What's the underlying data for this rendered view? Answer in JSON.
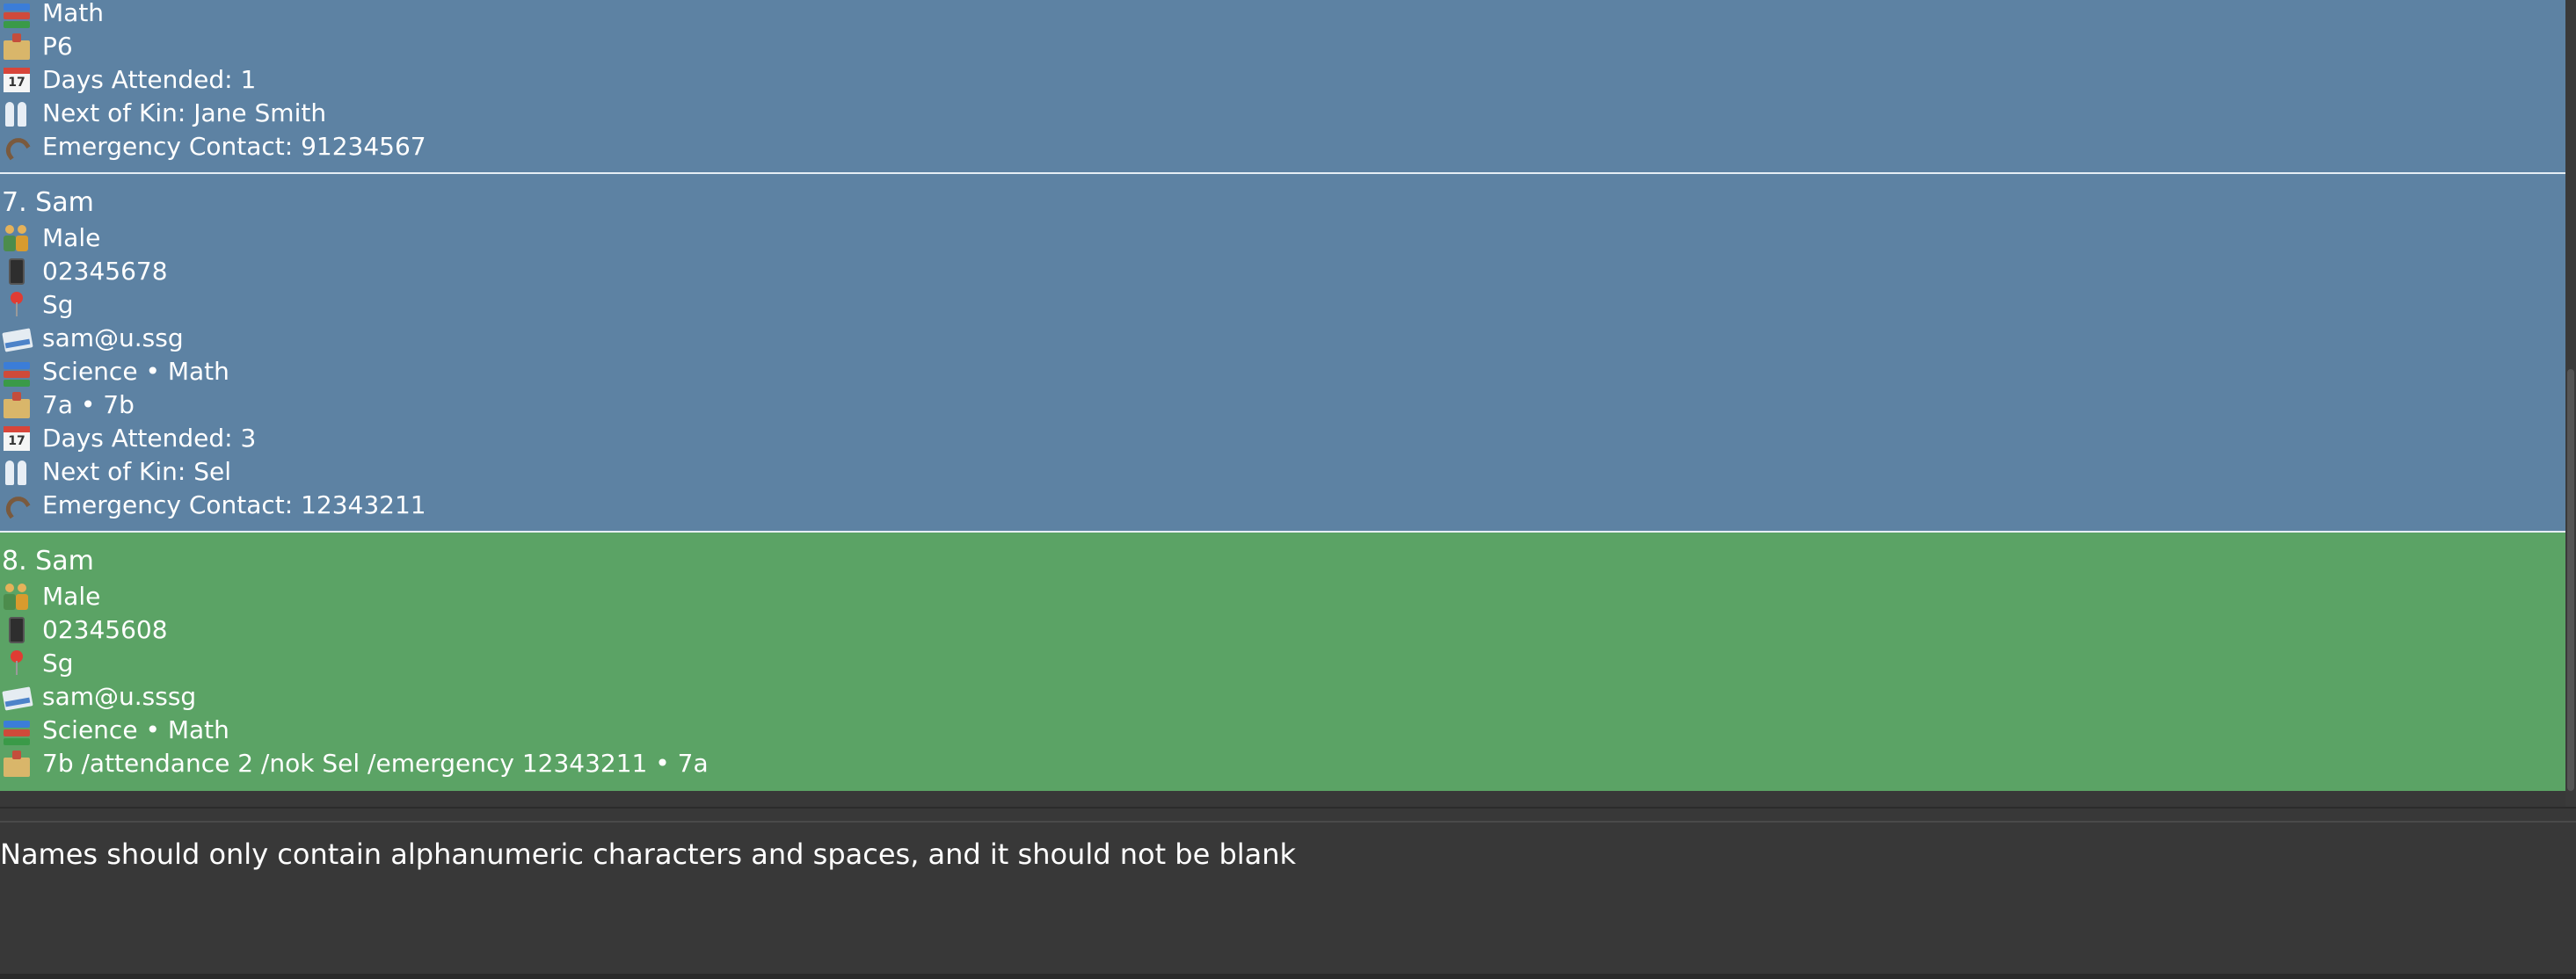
{
  "cards": {
    "partial": {
      "subjects": "Math",
      "classes": "P6",
      "days_attended": "Days Attended: 1",
      "next_of_kin": "Next of Kin: Jane Smith",
      "emergency_contact": "Emergency Contact: 91234567",
      "color": "#5d82a3"
    },
    "seven": {
      "title": "7. Sam",
      "gender": "Male",
      "phone": "02345678",
      "address": "Sg",
      "email": "sam@u.ssg",
      "subjects": "Science • Math",
      "classes": "7a • 7b",
      "days_attended": "Days Attended: 3",
      "next_of_kin": "Next of Kin: Sel",
      "emergency_contact": "Emergency Contact: 12343211",
      "color": "#5d82a3"
    },
    "eight": {
      "title": "8. Sam",
      "gender": "Male",
      "phone": "02345608",
      "address": "Sg",
      "email": "sam@u.sssg",
      "subjects": "Science • Math",
      "classes": "7b /attendance 2 /nok Sel /emergency 12343211 • 7a",
      "color": "#5ba365"
    }
  },
  "result_display": {
    "message": "Names should only contain alphanumeric characters and spaces, and it should not be blank"
  },
  "colors": {
    "background": "#383838",
    "selected_card": "#5ba365",
    "card": "#5d82a3",
    "text": "#ffffff"
  }
}
